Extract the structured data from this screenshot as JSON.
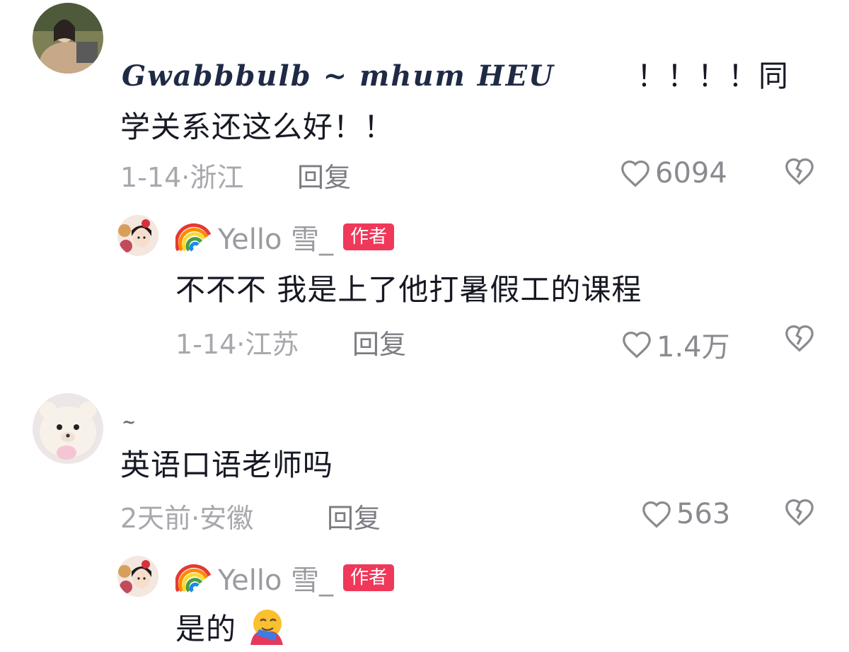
{
  "comments": [
    {
      "username": "Gwabbbulb ~ mhum HEU",
      "text_line1": "！！！！同",
      "text_line2": "学关系还这么好！！",
      "date_location": "1-14·浙江",
      "reply_label": "回复",
      "likes": "6094",
      "reply": {
        "username": "Yello 雪_",
        "badge": "作者",
        "text": "不不不 我是上了他打暑假工的课程",
        "date_location": "1-14·江苏",
        "reply_label": "回复",
        "likes": "1.4万"
      }
    },
    {
      "username": "~",
      "text": "英语口语老师吗",
      "date_location": "2天前·安徽",
      "reply_label": "回复",
      "likes": "563",
      "reply": {
        "username": "Yello 雪_",
        "badge": "作者",
        "text": "是的"
      }
    }
  ],
  "icons": {
    "like": "heart-outline-icon",
    "dislike": "broken-heart-icon",
    "rainbow": "rainbow-emoji",
    "hug": "hugging-face-emoji"
  },
  "colors": {
    "badge": "#f0385a",
    "text": "#161823",
    "meta": "#a7a8ad"
  }
}
